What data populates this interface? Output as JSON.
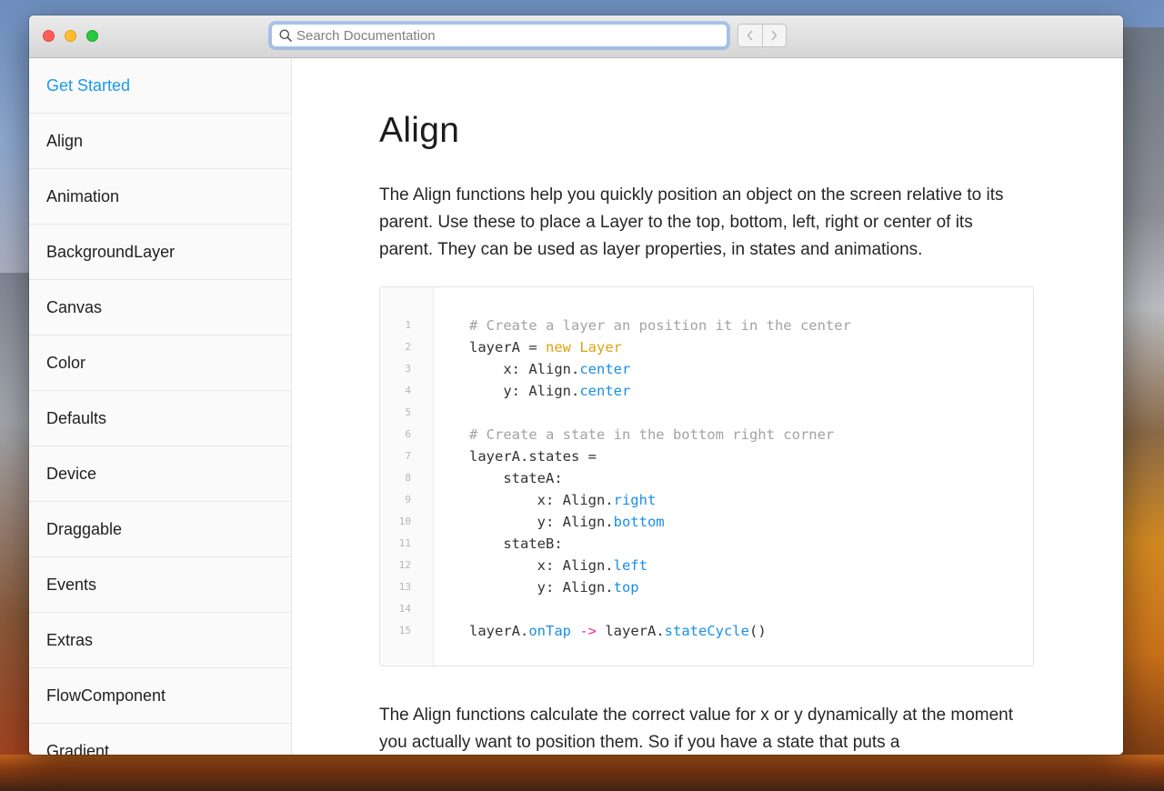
{
  "search": {
    "placeholder": "Search Documentation"
  },
  "sidebar": {
    "items": [
      {
        "label": "Get Started",
        "active": true
      },
      {
        "label": "Align"
      },
      {
        "label": "Animation"
      },
      {
        "label": "BackgroundLayer"
      },
      {
        "label": "Canvas"
      },
      {
        "label": "Color"
      },
      {
        "label": "Defaults"
      },
      {
        "label": "Device"
      },
      {
        "label": "Draggable"
      },
      {
        "label": "Events"
      },
      {
        "label": "Extras"
      },
      {
        "label": "FlowComponent"
      },
      {
        "label": "Gradient"
      }
    ]
  },
  "main": {
    "title": "Align",
    "intro": "The Align functions help you quickly position an object on the screen relative to its parent. Use these to place a Layer to the top, bottom, left, right or center of its parent. They can be used as layer properties, in states and animations.",
    "code": {
      "line_numbers": [
        "1",
        "2",
        "3",
        "4",
        "5",
        "6",
        "7",
        "8",
        "9",
        "10",
        "11",
        "12",
        "13",
        "14",
        "15"
      ],
      "lines": [
        [
          {
            "t": "# Create a layer an position it in the center",
            "c": "comment"
          }
        ],
        [
          {
            "t": "layerA = ",
            "c": "plain"
          },
          {
            "t": "new Layer",
            "c": "kw"
          }
        ],
        [
          {
            "t": "    x: Align.",
            "c": "plain"
          },
          {
            "t": "center",
            "c": "prop"
          }
        ],
        [
          {
            "t": "    y: Align.",
            "c": "plain"
          },
          {
            "t": "center",
            "c": "prop"
          }
        ],
        [],
        [
          {
            "t": "# Create a state in the bottom right corner",
            "c": "comment"
          }
        ],
        [
          {
            "t": "layerA.states =",
            "c": "plain"
          }
        ],
        [
          {
            "t": "    stateA:",
            "c": "plain"
          }
        ],
        [
          {
            "t": "        x: Align.",
            "c": "plain"
          },
          {
            "t": "right",
            "c": "prop"
          }
        ],
        [
          {
            "t": "        y: Align.",
            "c": "plain"
          },
          {
            "t": "bottom",
            "c": "prop"
          }
        ],
        [
          {
            "t": "    stateB:",
            "c": "plain"
          }
        ],
        [
          {
            "t": "        x: Align.",
            "c": "plain"
          },
          {
            "t": "left",
            "c": "prop"
          }
        ],
        [
          {
            "t": "        y: Align.",
            "c": "plain"
          },
          {
            "t": "top",
            "c": "prop"
          }
        ],
        [],
        [
          {
            "t": "layerA.",
            "c": "plain"
          },
          {
            "t": "onTap",
            "c": "prop"
          },
          {
            "t": " -> ",
            "c": "arrow"
          },
          {
            "t": "layerA.",
            "c": "plain"
          },
          {
            "t": "stateCycle",
            "c": "prop"
          },
          {
            "t": "()",
            "c": "plain"
          }
        ]
      ]
    },
    "followup": "The Align functions calculate the correct value for x or y dynamically at the moment you actually want to position them. So if you have a state that puts a"
  },
  "colors": {
    "accent": "#1a9af0",
    "code_keyword": "#e0a20f",
    "code_property": "#1a8fe8",
    "code_comment": "#a3a3a3",
    "code_arrow": "#e8348f"
  },
  "icons": {
    "search": "search-icon",
    "back": "chevron-left-icon",
    "forward": "chevron-right-icon"
  }
}
